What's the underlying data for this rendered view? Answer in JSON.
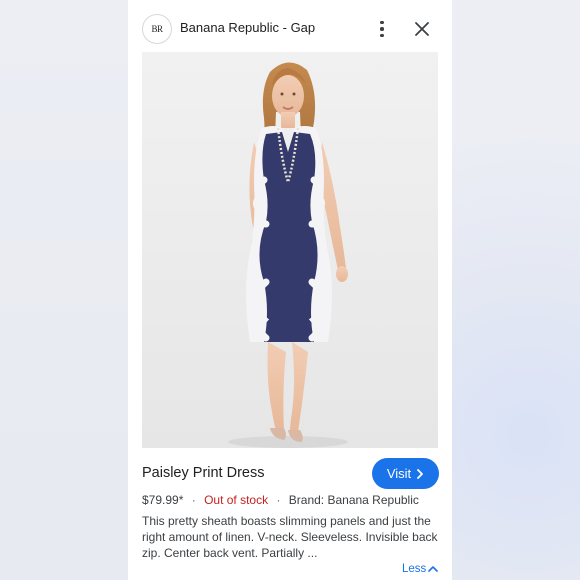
{
  "header": {
    "logo_text": "BR",
    "site_name": "Banana Republic - Gap",
    "more_icon": "more-vert-icon",
    "close_icon": "close-icon"
  },
  "product": {
    "title": "Paisley Print Dress",
    "visit_label": "Visit",
    "price": "$79.99*",
    "stock_status": "Out of stock",
    "brand": "Brand: Banana Republic",
    "description": "This pretty sheath boasts slimming panels and just the right amount of linen. V-neck. Sleeveless. Invisible back zip. Center back vent. Partially ...",
    "less_label": "Less"
  },
  "colors": {
    "accent": "#1a73e8",
    "out_of_stock": "#c5221f",
    "dress_navy": "#343a6b"
  }
}
